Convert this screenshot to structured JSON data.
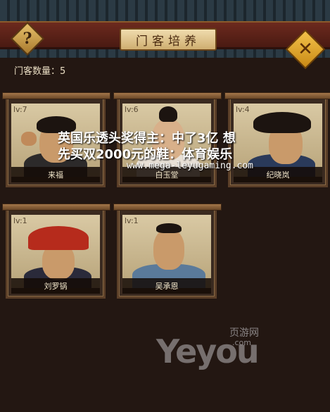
{
  "header": {
    "title": "门客培养",
    "help_label": "?",
    "close_label": "✕"
  },
  "count": {
    "text": "门客数量：5"
  },
  "retainers": [
    {
      "level": "lv:7",
      "name": "来福"
    },
    {
      "level": "lv:6",
      "name": "白玉堂"
    },
    {
      "level": "lv:4",
      "name": "纪晓岚"
    },
    {
      "level": "lv:1",
      "name": "刘罗锅"
    },
    {
      "level": "lv:1",
      "name": "吴承恩"
    }
  ],
  "overlay": {
    "line1": "英国乐透头奖得主：中了3亿 想",
    "line2": "先买双2000元的鞋：体育娱乐",
    "url": "www.mega-leyugaming.com"
  },
  "watermark": {
    "main": "Yeyou",
    "cn": "页游网",
    "com": ".com"
  },
  "icons": {
    "help": "question-mark-icon",
    "close": "close-icon"
  }
}
